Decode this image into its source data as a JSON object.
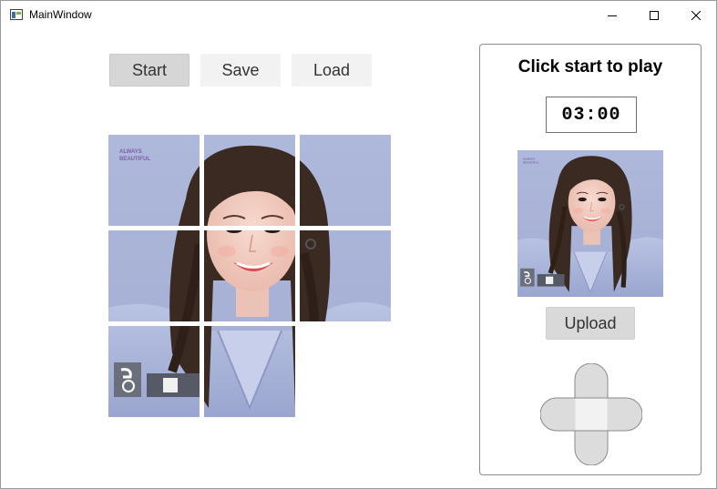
{
  "window": {
    "title": "MainWindow"
  },
  "toolbar": {
    "start_label": "Start",
    "save_label": "Save",
    "load_label": "Load"
  },
  "panel": {
    "status_text": "Click start to play",
    "timer": "03:00",
    "upload_label": "Upload"
  },
  "puzzle": {
    "grid": "3x3",
    "empty_cell": "bottom-right"
  },
  "image_caption": "ALWAYS BEAUTIFUL",
  "colors": {
    "button_gray": "#d6d6d6",
    "button_light": "#f2f2f2",
    "photo_bg": "#a9b4d6",
    "hair": "#3a2a22"
  }
}
